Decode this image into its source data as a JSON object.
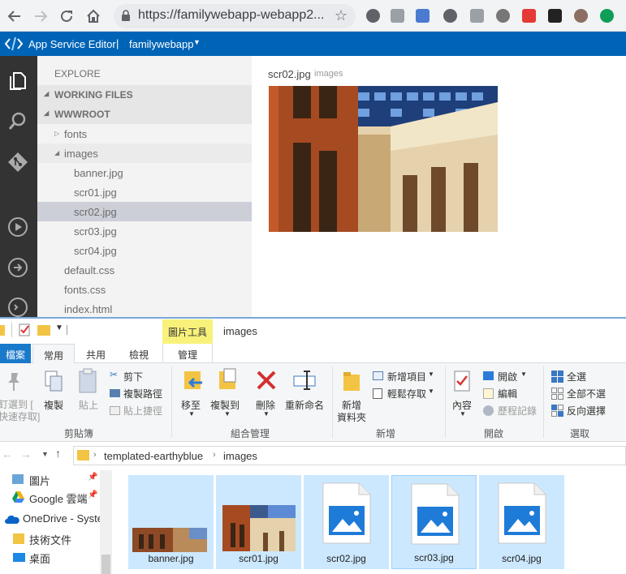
{
  "browser": {
    "url": "https://familywebapp-webapp2...",
    "icons": [
      "back-icon",
      "forward-icon",
      "reload-icon",
      "home-icon",
      "lock-icon",
      "star-icon"
    ]
  },
  "ase": {
    "title": "App Service Editor",
    "separator": "|",
    "site": "familywebapp"
  },
  "explorer": {
    "header": "EXPLORE",
    "working_files": "WORKING FILES",
    "root": "WWWROOT",
    "tree": [
      {
        "label": "fonts",
        "level": 1,
        "folder": true,
        "open": false
      },
      {
        "label": "images",
        "level": 1,
        "folder": true,
        "open": true
      },
      {
        "label": "banner.jpg",
        "level": 2
      },
      {
        "label": "scr01.jpg",
        "level": 2
      },
      {
        "label": "scr02.jpg",
        "level": 2,
        "selected": true
      },
      {
        "label": "scr03.jpg",
        "level": 2
      },
      {
        "label": "scr04.jpg",
        "level": 2
      },
      {
        "label": "default.css",
        "level": 1
      },
      {
        "label": "fonts.css",
        "level": 1
      },
      {
        "label": "index.html",
        "level": 1
      }
    ]
  },
  "editor": {
    "file": "scr02.jpg",
    "folder": "images"
  },
  "fileexplorer": {
    "context_tab": "圖片工具",
    "title": "images",
    "tabs": {
      "file": "檔案",
      "home": "常用",
      "share": "共用",
      "view": "檢視",
      "manage": "管理"
    },
    "clipboard": {
      "pin": "釘選到 [",
      "pin2": "快速存取]",
      "copy": "複製",
      "paste": "貼上",
      "cut": "剪下",
      "copy_path": "複製路徑",
      "paste_shortcut": "貼上捷徑",
      "label": "剪貼簿"
    },
    "organize": {
      "move": "移至",
      "copy_to": "複製到",
      "delete": "刪除",
      "rename": "重新命名",
      "label": "組合管理"
    },
    "new": {
      "new_folder": "新增",
      "new_folder2": "資料夾",
      "new_item": "新增項目",
      "easy_access": "輕鬆存取",
      "label": "新增"
    },
    "open": {
      "properties": "內容",
      "open": "開啟",
      "edit": "編輯",
      "history": "歷程記錄",
      "label": "開啟"
    },
    "select": {
      "all": "全選",
      "none": "全部不選",
      "invert": "反向選擇",
      "label": "選取"
    },
    "breadcrumb": [
      "templated-earthyblue",
      "images"
    ],
    "nav": [
      {
        "label": "圖片"
      },
      {
        "label": "Google 雲端"
      },
      {
        "label": "OneDrive - Syste"
      },
      {
        "label": "技術文件"
      },
      {
        "label": "桌面"
      }
    ],
    "files": [
      {
        "name": "banner.jpg",
        "kind": "photo-banner"
      },
      {
        "name": "scr01.jpg",
        "kind": "photo"
      },
      {
        "name": "scr02.jpg",
        "kind": "generic"
      },
      {
        "name": "scr03.jpg",
        "kind": "generic",
        "selected": true
      },
      {
        "name": "scr04.jpg",
        "kind": "generic"
      }
    ]
  }
}
